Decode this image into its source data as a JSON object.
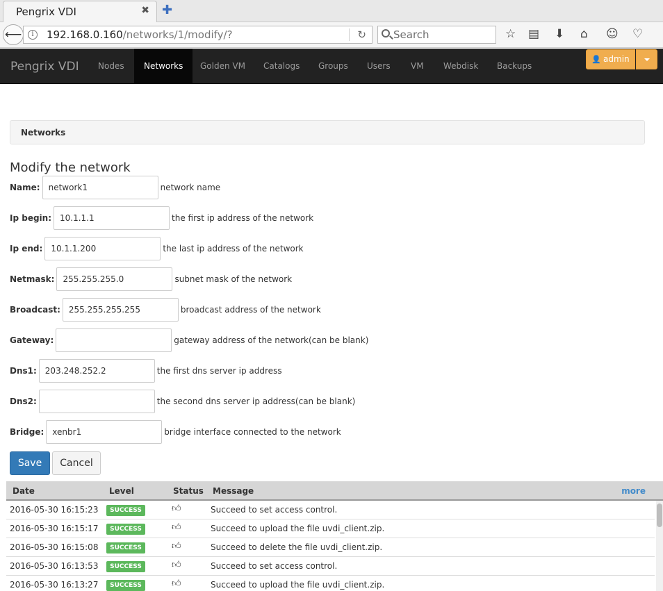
{
  "browser": {
    "tab_title": "Pengrix VDI",
    "tab_close": "✖",
    "new_tab": "✚",
    "url_host": "192.168.0.160",
    "url_path": "/networks/1/modify/?",
    "search_placeholder": "Search",
    "icons": [
      "back-arrow-icon",
      "info-icon",
      "reload-icon",
      "bookmark-star-icon",
      "reading-list-icon",
      "download-icon",
      "home-icon",
      "smiley-icon",
      "pocket-icon"
    ]
  },
  "nav": {
    "brand": "Pengrix VDI",
    "items": [
      {
        "label": "Nodes",
        "active": false
      },
      {
        "label": "Networks",
        "active": true
      },
      {
        "label": "Golden VM",
        "active": false
      },
      {
        "label": "Catalogs",
        "active": false
      },
      {
        "label": "Groups",
        "active": false
      },
      {
        "label": "Users",
        "active": false
      },
      {
        "label": "VM",
        "active": false
      },
      {
        "label": "Webdisk",
        "active": false
      },
      {
        "label": "Backups",
        "active": false
      }
    ],
    "admin_label": "admin",
    "accent": "#f0ad4e"
  },
  "breadcrumb": "Networks",
  "form": {
    "title": "Modify the network",
    "fields": [
      {
        "label": "Name:",
        "value": "network1",
        "help": "network name"
      },
      {
        "label": "Ip begin:",
        "value": "10.1.1.1",
        "help": "the first ip address of the network"
      },
      {
        "label": "Ip end:",
        "value": "10.1.1.200",
        "help": "the last ip address of the network"
      },
      {
        "label": "Netmask:",
        "value": "255.255.255.0",
        "help": "subnet mask of the network"
      },
      {
        "label": "Broadcast:",
        "value": "255.255.255.255",
        "help": "broadcast address of the network"
      },
      {
        "label": "Gateway:",
        "value": "",
        "help": "gateway address of the network(can be blank)"
      },
      {
        "label": "Dns1:",
        "value": "203.248.252.2",
        "help": "the first dns server ip address"
      },
      {
        "label": "Dns2:",
        "value": "",
        "help": "the second dns server ip address(can be blank)"
      },
      {
        "label": "Bridge:",
        "value": "xenbr1",
        "help": "bridge interface connected to the network"
      }
    ],
    "save_label": "Save",
    "cancel_label": "Cancel",
    "primary_color": "#337ab7"
  },
  "log": {
    "headers": {
      "date": "Date",
      "level": "Level",
      "status": "Status",
      "message": "Message"
    },
    "more_label": "more",
    "rows": [
      {
        "date": "2016-05-30 16:15:23",
        "level": "SUCCESS",
        "message": "Succeed to set access control."
      },
      {
        "date": "2016-05-30 16:15:17",
        "level": "SUCCESS",
        "message": "Succeed to upload the file uvdi_client.zip."
      },
      {
        "date": "2016-05-30 16:15:08",
        "level": "SUCCESS",
        "message": "Succeed to delete the file uvdi_client.zip."
      },
      {
        "date": "2016-05-30 16:13:53",
        "level": "SUCCESS",
        "message": "Succeed to set access control."
      },
      {
        "date": "2016-05-30 16:13:27",
        "level": "SUCCESS",
        "message": "Succeed to upload the file uvdi_client.zip."
      }
    ],
    "success_color": "#5cb85c"
  }
}
